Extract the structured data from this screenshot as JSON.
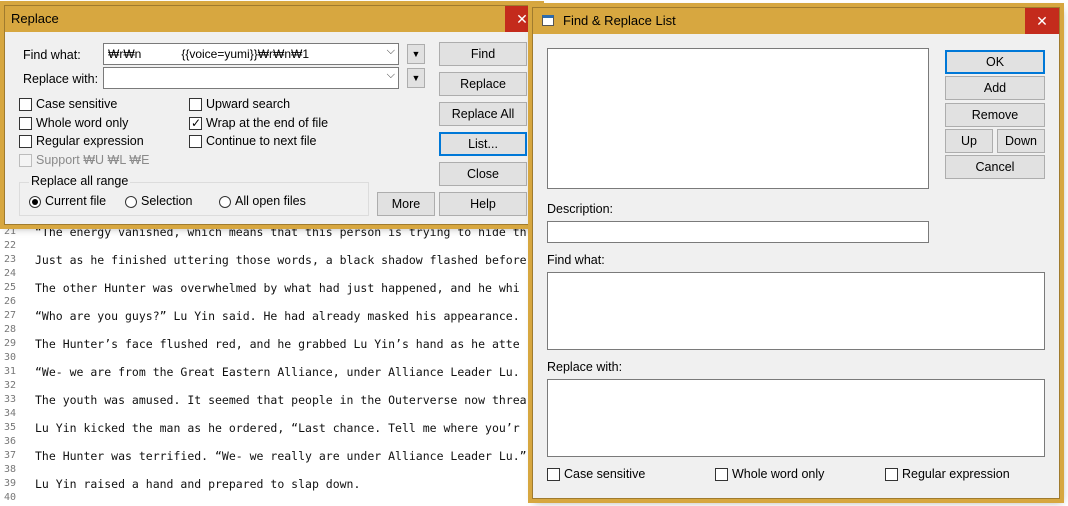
{
  "editor": {
    "lines": [
      {
        "n": "21",
        "t": "“The energy vanished, which means that this person is trying to hide th"
      },
      {
        "n": "22",
        "t": ""
      },
      {
        "n": "23",
        "t": "Just as he finished uttering those words, a black shadow flashed before"
      },
      {
        "n": "24",
        "t": ""
      },
      {
        "n": "25",
        "t": "The other Hunter was overwhelmed by what had just happened, and he whi"
      },
      {
        "n": "26",
        "t": ""
      },
      {
        "n": "27",
        "t": "“Who are you guys?” Lu Yin said. He had already masked his appearance."
      },
      {
        "n": "28",
        "t": ""
      },
      {
        "n": "29",
        "t": "The Hunter’s face flushed red, and he grabbed Lu Yin’s hand as he atte"
      },
      {
        "n": "30",
        "t": ""
      },
      {
        "n": "31",
        "t": "“We- we are from the Great Eastern Alliance, under Alliance Leader Lu."
      },
      {
        "n": "32",
        "t": ""
      },
      {
        "n": "33",
        "t": "The youth was amused. It seemed that people in the Outerverse now threa"
      },
      {
        "n": "34",
        "t": ""
      },
      {
        "n": "35",
        "t": "Lu Yin kicked the man as he ordered, “Last chance. Tell me where you’r"
      },
      {
        "n": "36",
        "t": ""
      },
      {
        "n": "37",
        "t": "The Hunter was terrified. “We- we really are under Alliance Leader Lu.”"
      },
      {
        "n": "38",
        "t": ""
      },
      {
        "n": "39",
        "t": "Lu Yin raised a hand and prepared to slap down."
      },
      {
        "n": "40",
        "t": ""
      }
    ]
  },
  "replace": {
    "title": "Replace",
    "close": "✕",
    "find_label": "Find what:",
    "find_value": "₩r₩n            {{voice=yumi}}₩r₩n₩1",
    "replace_label": "Replace with:",
    "replace_value": "",
    "options": {
      "case_sensitive": "Case sensitive",
      "whole_word": "Whole word only",
      "regex": "Regular expression",
      "support_escape": "Support ₩U ₩L ₩E",
      "upward": "Upward search",
      "wrap": "Wrap at the end of file",
      "continue": "Continue to next file"
    },
    "range_label": "Replace all range",
    "range_current": "Current file",
    "range_selection": "Selection",
    "range_all": "All open files",
    "buttons": {
      "find": "Find",
      "replace": "Replace",
      "replace_all": "Replace All",
      "list": "List...",
      "close": "Close",
      "more": "More",
      "help": "Help"
    }
  },
  "list": {
    "title": "Find & Replace List",
    "close": "✕",
    "description_label": "Description:",
    "find_label": "Find what:",
    "replace_label": "Replace with:",
    "buttons": {
      "ok": "OK",
      "add": "Add",
      "remove": "Remove",
      "up": "Up",
      "down": "Down",
      "cancel": "Cancel"
    },
    "options": {
      "case_sensitive": "Case sensitive",
      "whole_word": "Whole word only",
      "regex": "Regular expression"
    }
  },
  "colors": {
    "title_bar": "#d7a740",
    "close_button": "#c42b1c",
    "default_button_border": "#0078d7"
  }
}
